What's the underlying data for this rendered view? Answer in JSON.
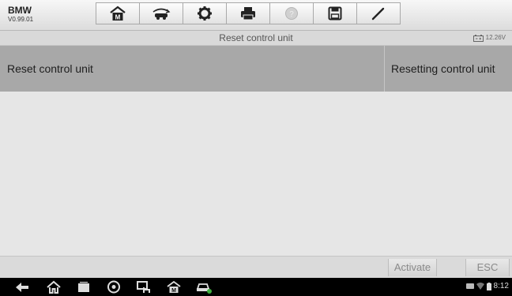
{
  "header": {
    "brand": "BMW",
    "version": "V0.99.01",
    "toolbar": [
      {
        "icon": "home-icon"
      },
      {
        "icon": "vehicle-swap-icon"
      },
      {
        "icon": "settings-gear-icon"
      },
      {
        "icon": "printer-icon"
      },
      {
        "icon": "help-icon"
      },
      {
        "icon": "save-icon"
      },
      {
        "icon": "edit-pen-icon"
      }
    ]
  },
  "subheader": {
    "title": "Reset control unit",
    "battery_voltage": "12.26V"
  },
  "table": {
    "row": {
      "function": "Reset control unit",
      "status": "Resetting control unit"
    }
  },
  "footer": {
    "activate_label": "Activate",
    "esc_label": "ESC"
  },
  "navbar": {
    "icons": [
      "back-icon",
      "home-icon",
      "recent-apps-icon",
      "browser-icon",
      "screen-capture-icon",
      "autel-home-icon",
      "vci-car-icon"
    ],
    "time": "8:12"
  },
  "colors": {
    "row_bg": "#a8a8a8",
    "content_bg": "#e6e6e6",
    "navbar_bg": "#000000"
  }
}
